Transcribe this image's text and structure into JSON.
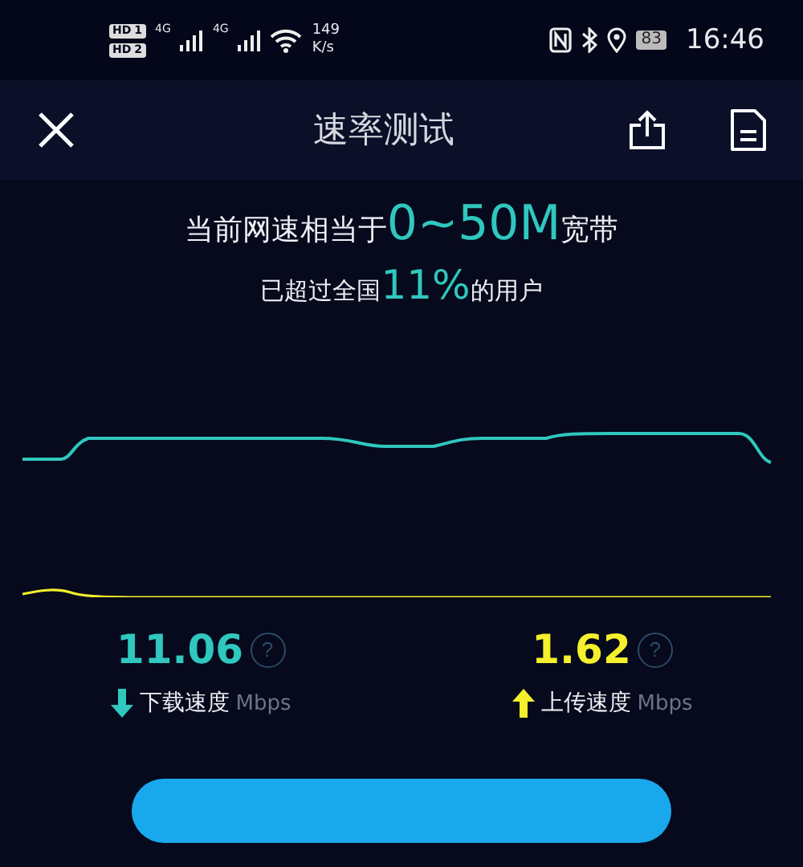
{
  "status_bar": {
    "sims": [
      {
        "label": "HD",
        "slot": "1",
        "network": "4G"
      },
      {
        "label": "HD",
        "slot": "2",
        "network": "4G"
      }
    ],
    "net_speed": [
      "149",
      "K/s"
    ],
    "battery": "83",
    "time": "16:46"
  },
  "header": {
    "title": "速率测试"
  },
  "summary": {
    "line1": [
      {
        "text": "当前网速相当于",
        "kind": "plain"
      },
      {
        "text": "0~50M",
        "kind": "highlight"
      },
      {
        "text": "宽带",
        "kind": "plain"
      }
    ],
    "line2": [
      {
        "text": "已超过全国",
        "kind": "plain"
      },
      {
        "text": "11%",
        "kind": "highlight"
      },
      {
        "text": "的用户",
        "kind": "plain"
      }
    ]
  },
  "results": [
    {
      "kind": "download",
      "value": "11.06",
      "help": "?",
      "label": "下载速度",
      "unit": "Mbps"
    },
    {
      "kind": "upload",
      "value": "1.62",
      "help": "?",
      "label": "上传速度",
      "unit": "Mbps"
    }
  ]
}
